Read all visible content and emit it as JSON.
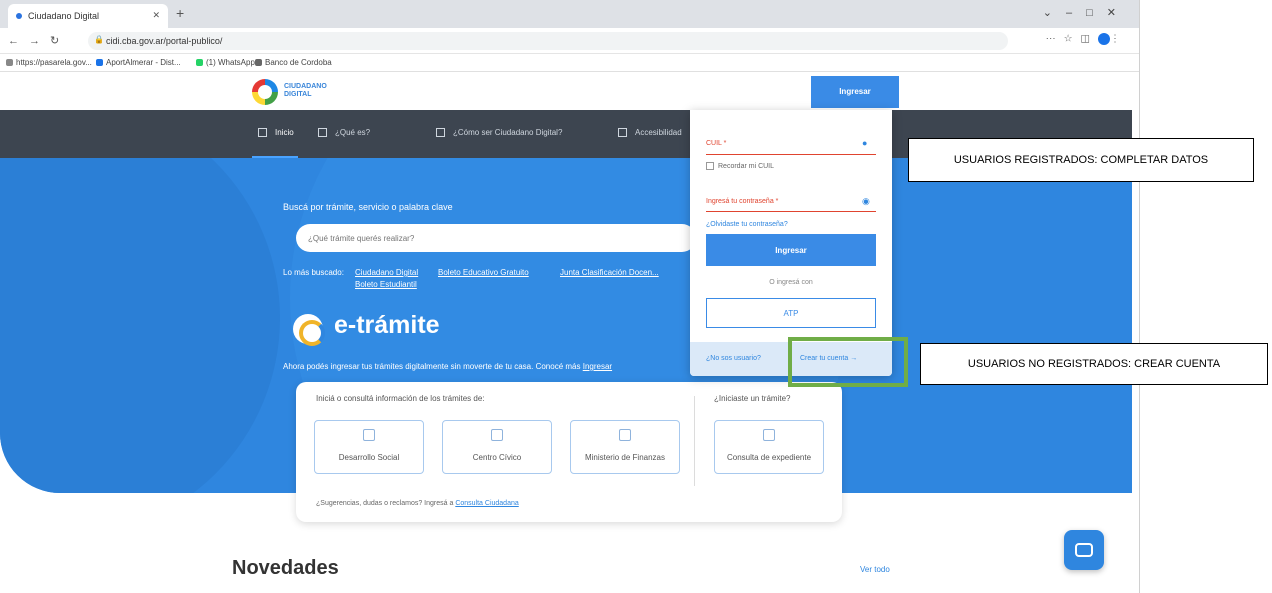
{
  "browser": {
    "tab_title": "Ciudadano Digital",
    "url": "cidi.cba.gov.ar/portal-publico/",
    "bookmarks": [
      "https://pasarela.gov...",
      "AportAlmerar - Dist...",
      "(1) WhatsApp",
      "Banco de Cordoba"
    ]
  },
  "header": {
    "logo_text_line1": "CIUDADANO",
    "logo_text_line2": "DIGITAL",
    "ingresar_label": "Ingresar"
  },
  "nav": {
    "items": [
      "Inicio",
      "¿Qué es?",
      "¿Cómo ser Ciudadano Digital?",
      "Accesibilidad"
    ]
  },
  "hero": {
    "search_label": "Buscá por trámite, servicio o palabra clave",
    "search_placeholder": "¿Qué trámite querés realizar?",
    "popular_label": "Lo más buscado:",
    "popular_links": [
      "Ciudadano Digital",
      "Boleto Educativo Gratuito",
      "Junta Clasificación Docen...",
      "Boleto Estudiantil"
    ],
    "etramite_title": "e-trámite",
    "etramite_desc": "Ahora podés ingresar tus trámites digitalmente sin moverte de tu casa. Conocé más",
    "etramite_link": "Ingresar"
  },
  "card": {
    "title": "Iniciá o consultá información de los trámites de:",
    "title_right": "¿Iniciaste un trámite?",
    "tiles": [
      "Desarrollo Social",
      "Centro Cívico",
      "Ministerio de Finanzas"
    ],
    "tile_right": "Consulta de expediente",
    "footer_text": "¿Sugerencias, dudas o reclamos? Ingresá a",
    "footer_link": "Consulta Ciudadana"
  },
  "novedades": {
    "title": "Novedades",
    "ver_todo": "Ver todo"
  },
  "login": {
    "cuil_label": "CUIL *",
    "remember_label": "Recordar mi CUIL",
    "password_label": "Ingresá tu contraseña *",
    "forgot_label": "¿Olvidaste tu contraseña?",
    "login_button": "Ingresar",
    "or_text": "O ingresá con",
    "atp_button": "ATP",
    "not_user": "¿No sos usuario?",
    "create_account": "Crear tu cuenta →"
  },
  "annotations": {
    "registered": "USUARIOS REGISTRADOS: COMPLETAR DATOS",
    "unregistered": "USUARIOS NO REGISTRADOS: CREAR CUENTA",
    "highlight_color": "#70ad47"
  }
}
